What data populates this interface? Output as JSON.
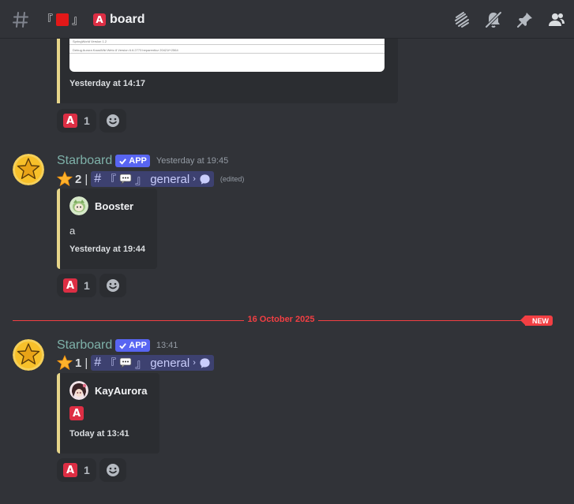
{
  "header": {
    "bracket_open": "『",
    "bracket_close": "』",
    "a_glyph": "A",
    "channel_name": "board",
    "icons": [
      "threads-icon",
      "notifications-muted-icon",
      "pin-icon",
      "members-icon"
    ]
  },
  "top_embed": {
    "image_line_1": "SpringWorld Version 1.2",
    "image_line_2": "Debug Aurora KaosWiki Weto 8 Version 6.6.2773 beparenticz 20421f+2564",
    "footer_time": "Yesterday at 14:17",
    "reactions": [
      {
        "emoji": "A",
        "count": "1"
      }
    ]
  },
  "messages": [
    {
      "username": "Starboard",
      "badge": "APP",
      "timestamp": "Yesterday at 19:45",
      "star_count": "2",
      "pipe": "|",
      "mention": {
        "hash": "#",
        "open": "『",
        "close": "』",
        "name": "general",
        "chevron": "›"
      },
      "edited": "(edited)",
      "embed": {
        "author": "Booster",
        "text": "a",
        "footer": "Yesterday at 19:44"
      },
      "reactions": [
        {
          "emoji": "A",
          "count": "1"
        }
      ]
    },
    {
      "username": "Starboard",
      "badge": "APP",
      "timestamp": "13:41",
      "star_count": "1",
      "pipe": "|",
      "mention": {
        "hash": "#",
        "open": "『",
        "close": "』",
        "name": "general",
        "chevron": "›"
      },
      "embed": {
        "author": "KayAurora",
        "text": "A",
        "footer": "Today at 13:41"
      },
      "reactions": [
        {
          "emoji": "A",
          "count": "1"
        }
      ]
    }
  ],
  "divider": {
    "date": "16 October 2025",
    "new_label": "NEW"
  },
  "colors": {
    "background": "#313338",
    "embed_bg": "#2b2d31",
    "embed_accent": "#e6d58a",
    "username": "#7eb1a9",
    "app_badge": "#5865f2",
    "new_red": "#f23f43",
    "a_emoji": "#dd2e44"
  }
}
